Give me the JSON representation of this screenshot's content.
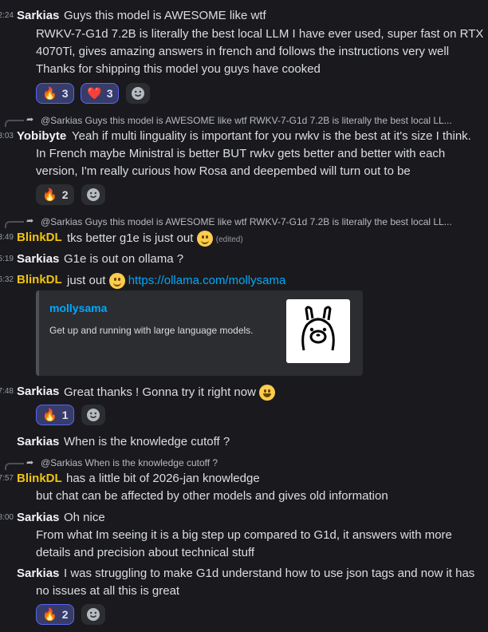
{
  "messages": [
    {
      "time": "2:24",
      "author": "Sarkias",
      "author_color": "#f2f3f5",
      "lines": [
        "Guys this model is AWESOME like wtf",
        "RWKV-7-G1d 7.2B is literally the best local LLM I have ever used, super fast on RTX",
        "4070Ti, gives amazing answers in french and follows the instructions very well",
        "Thanks for shipping this model you guys have cooked"
      ],
      "reactions": [
        {
          "emoji": "🔥",
          "count": "3",
          "mine": true
        },
        {
          "emoji": "❤️",
          "count": "3",
          "mine": true
        }
      ]
    },
    {
      "reply": {
        "name": "@Sarkias",
        "text": "Guys this model is AWESOME like wtf RWKV-7-G1d 7.2B is literally the best local LL..."
      },
      "time": "3:03",
      "author": "Yobibyte",
      "author_color": "#f2f3f5",
      "lines": [
        "Yeah if multi linguality is important for you rwkv is the best at it's size I think.",
        "In French maybe Ministral is better BUT rwkv gets better and better with each",
        "version, I'm really curious how Rosa and deepembed will turn out to be"
      ],
      "reactions": [
        {
          "emoji": "🔥",
          "count": "2",
          "mine": false
        }
      ]
    },
    {
      "reply": {
        "name": "@Sarkias",
        "text": "Guys this model is AWESOME like wtf RWKV-7-G1d 7.2B is literally the best local LL..."
      },
      "time": "3:49",
      "author": "BlinkDL",
      "author_color": "#f1c40f",
      "text": "tks better g1e is just out",
      "edited": "(edited)"
    },
    {
      "time": "5:19",
      "author": "Sarkias",
      "author_color": "#f2f3f5",
      "text": "G1e is out on ollama ?"
    },
    {
      "time": "6:32",
      "author": "BlinkDL",
      "author_color": "#f1c40f",
      "text": "just out",
      "link": "https://ollama.com/mollysama",
      "embed": {
        "title": "mollysama",
        "description": "Get up and running with large language models."
      }
    },
    {
      "time": "7:48",
      "author": "Sarkias",
      "author_color": "#f2f3f5",
      "text": "Great thanks ! Gonna try it right now",
      "reactions": [
        {
          "emoji": "🔥",
          "count": "1",
          "mine": true
        }
      ]
    },
    {
      "author": "Sarkias",
      "author_color": "#f2f3f5",
      "text": "When is the knowledge cutoff ?"
    },
    {
      "reply": {
        "name": "@Sarkias",
        "text": "When is the knowledge cutoff ?"
      },
      "time": "7:57",
      "author": "BlinkDL",
      "author_color": "#f1c40f",
      "lines": [
        "has a little bit of 2026-jan knowledge",
        "but chat can be affected by other models and gives old information"
      ]
    },
    {
      "time": "8:00",
      "author": "Sarkias",
      "author_color": "#f2f3f5",
      "lines": [
        "Oh nice",
        "From what Im seeing it is a big step up compared to G1d, it answers with more",
        "details and precision about technical stuff"
      ]
    },
    {
      "author": "Sarkias",
      "author_color": "#f2f3f5",
      "lines": [
        "I was struggling to make G1d understand how to use json tags and now it has",
        "no issues at all this is great"
      ],
      "reactions": [
        {
          "emoji": "🔥",
          "count": "2",
          "mine": true
        }
      ]
    }
  ],
  "add_reaction_icon": "emoji-add-icon",
  "colors": {
    "background": "#1a1a1e",
    "link": "#00a8fc",
    "reaction_selected": "#5865f2"
  }
}
